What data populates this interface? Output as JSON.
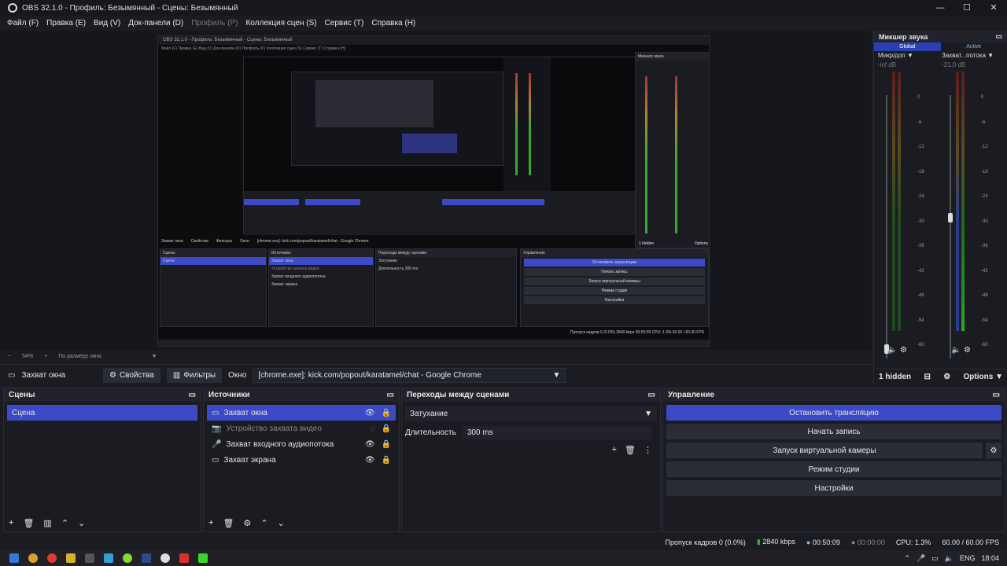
{
  "window": {
    "title": "OBS 32.1.0 - Профиль: Безымянный - Сцены: Безымянный",
    "minimize": "—",
    "maximize": "☐",
    "close": "✕"
  },
  "menu": [
    {
      "label": "Файл (F)"
    },
    {
      "label": "Правка (E)"
    },
    {
      "label": "Вид (V)"
    },
    {
      "label": "Док-панели (D)"
    },
    {
      "label": "Профиль (P)"
    },
    {
      "label": "Коллекция сцен (S)"
    },
    {
      "label": "Сервис (T)"
    },
    {
      "label": "Справка (H)"
    }
  ],
  "preview": {
    "mini_title": "OBS 32.1.0 - Профиль: Безымянный - Сцены: Безымянный",
    "mini_menu": "Файл (F)  Правка (E)  Вид (V)  Док-панели (D)  Профиль (P)  Коллекция сцен (S)  Сервис (T)  Справка (H)",
    "mini_context": "Захват окна",
    "mini_props": "Свойства",
    "mini_filters": "Фильтры",
    "mini_window_label": "Окно",
    "mini_window_value": "[chrome.exe]: kick.com/popout/karatamel/chat - Google Chrome",
    "mini_scenes": "Сцены",
    "mini_scene": "Сцена",
    "mini_sources": "Источники",
    "mini_src": [
      "Захват окна",
      "Устройство захвата видео",
      "Захват входного аудиопотока",
      "Захват экрана"
    ],
    "mini_transitions": "Переходы между сценами",
    "mini_fade": "Затухание",
    "mini_duration": "Длительность",
    "mini_duration_val": "300 ms",
    "mini_controls": "Управление",
    "mini_ctl": [
      "Остановить трансляцию",
      "Начать запись",
      "Запуск виртуальной камеры",
      "Режим студии",
      "Настройки"
    ],
    "mini_mixer": "Микшер звука",
    "mini_hidden": "1 hidden",
    "mini_options": "Options",
    "mini_status": "Пропуск кадров 0 (0.0%)   2840 kbps   00:50:09   CPU: 1.3%   60.00 / 60.00 FPS"
  },
  "zoom": {
    "minus": "−",
    "value": "54%",
    "plus": "+",
    "mode": "По размеру окна"
  },
  "mixer": {
    "title": "Микшер звука",
    "tab_global": "Global",
    "tab_active": "Active",
    "channels": [
      {
        "name": "Микр/доп",
        "db": "-inf dB"
      },
      {
        "name": "Захват...потока",
        "db": "-21.0 dB"
      }
    ],
    "scale": [
      "0",
      "-6",
      "-12",
      "-18",
      "-24",
      "-30",
      "-36",
      "-42",
      "-48",
      "-54",
      "-60"
    ],
    "hidden": "1 hidden",
    "options": "Options"
  },
  "context": {
    "source": "Захват окна",
    "properties": "Свойства",
    "filters": "Фильтры",
    "window_label": "Окно",
    "window_value": "[chrome.exe]: kick.com/popout/karatamel/chat - Google Chrome"
  },
  "scenes": {
    "title": "Сцены",
    "items": [
      "Сцена"
    ]
  },
  "sources": {
    "title": "Источники",
    "items": [
      {
        "name": "Захват окна",
        "icon": "window-icon"
      },
      {
        "name": "Устройство захвата видео",
        "icon": "camera-icon"
      },
      {
        "name": "Захват входного аудиопотока",
        "icon": "microphone-icon"
      },
      {
        "name": "Захват экрана",
        "icon": "monitor-icon"
      }
    ]
  },
  "transitions": {
    "title": "Переходы между сценами",
    "type": "Затухание",
    "duration_label": "Длительность",
    "duration_value": "300 ms"
  },
  "controls": {
    "title": "Управление",
    "stop_stream": "Остановить трансляцию",
    "start_record": "Начать запись",
    "virtual_cam": "Запуск виртуальной камеры",
    "studio_mode": "Режим студии",
    "settings": "Настройки"
  },
  "status": {
    "dropped": "Пропуск кадров 0 (0.0%)",
    "bitrate": "2840 kbps",
    "stream_time": "00:50:09",
    "record_time": "00:00:00",
    "cpu": "CPU: 1.3%",
    "fps": "60.00 / 60.00 FPS"
  },
  "taskbar": {
    "lang": "ENG",
    "time": "18:04"
  },
  "colors": {
    "accent": "#3c4ac8",
    "bg": "#1b1c22",
    "panel_header": "#22232a"
  }
}
